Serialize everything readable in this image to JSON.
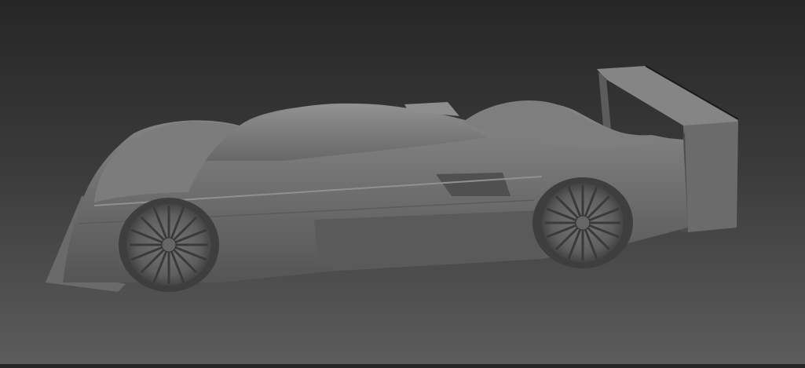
{
  "scene": {
    "subject": "race-car-model",
    "colors": {
      "background_top": "#262626",
      "background_bottom": "#5c5c5c",
      "body": "#6e6e6e",
      "body_light": "#8a8a8a",
      "body_dark": "#4a4a4a",
      "wheel": "#5a5a5a"
    }
  }
}
